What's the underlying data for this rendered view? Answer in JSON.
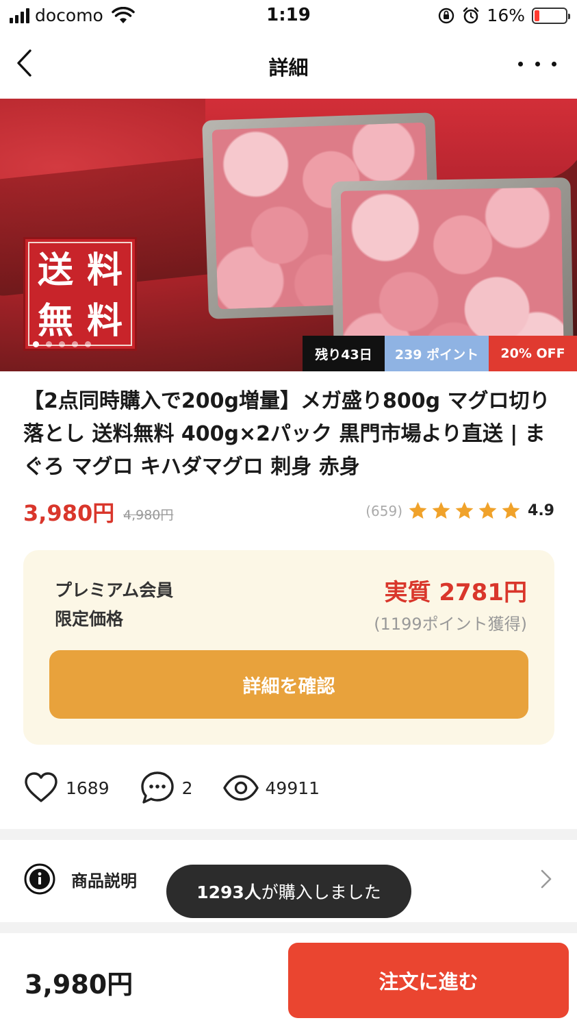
{
  "status_bar": {
    "carrier": "docomo",
    "time": "1:19",
    "battery_percent": "16%",
    "battery_level": 0.16
  },
  "nav": {
    "title": "詳細",
    "back_icon": "chevron-left-icon",
    "more_icon": "more-horizontal-icon"
  },
  "hero": {
    "badge_chars": [
      "送",
      "料",
      "無",
      "料"
    ],
    "carousel_count": 5,
    "carousel_active_index": 0,
    "tags": {
      "days_left": "残り43日",
      "points": "239 ポイント",
      "discount": "20% OFF"
    }
  },
  "product": {
    "title": "【2点同時購入で200g増量】メガ盛り800g マグロ切り落とし 送料無料 400g×2パック 黒門市場より直送 | まぐろ マグロ キハダマグロ 刺身 赤身",
    "price": "3,980円",
    "original_price": "4,980円",
    "review_count": "(659)",
    "rating": "4.9",
    "rating_stars": 5
  },
  "premium": {
    "label_line1": "プレミアム会員",
    "label_line2": "限定価格",
    "effective_price": "実質 2781円",
    "points_earned": "(1199ポイント獲得)",
    "button_label": "詳細を確認"
  },
  "stats": {
    "likes": "1689",
    "comments": "2",
    "views": "49911"
  },
  "description": {
    "label": "商品説明"
  },
  "toast": {
    "count": "1293人",
    "text": "が購入しました"
  },
  "bottom": {
    "price": "3,980円",
    "order_button": "注文に進む"
  },
  "colors": {
    "accent_red": "#d9362b",
    "order_button": "#ea4530",
    "detail_button": "#e8a23c",
    "premium_bg": "#fcf7e6",
    "star": "#f0a22a",
    "tag_points": "#8fb3e3",
    "tag_off": "#e03a30"
  }
}
